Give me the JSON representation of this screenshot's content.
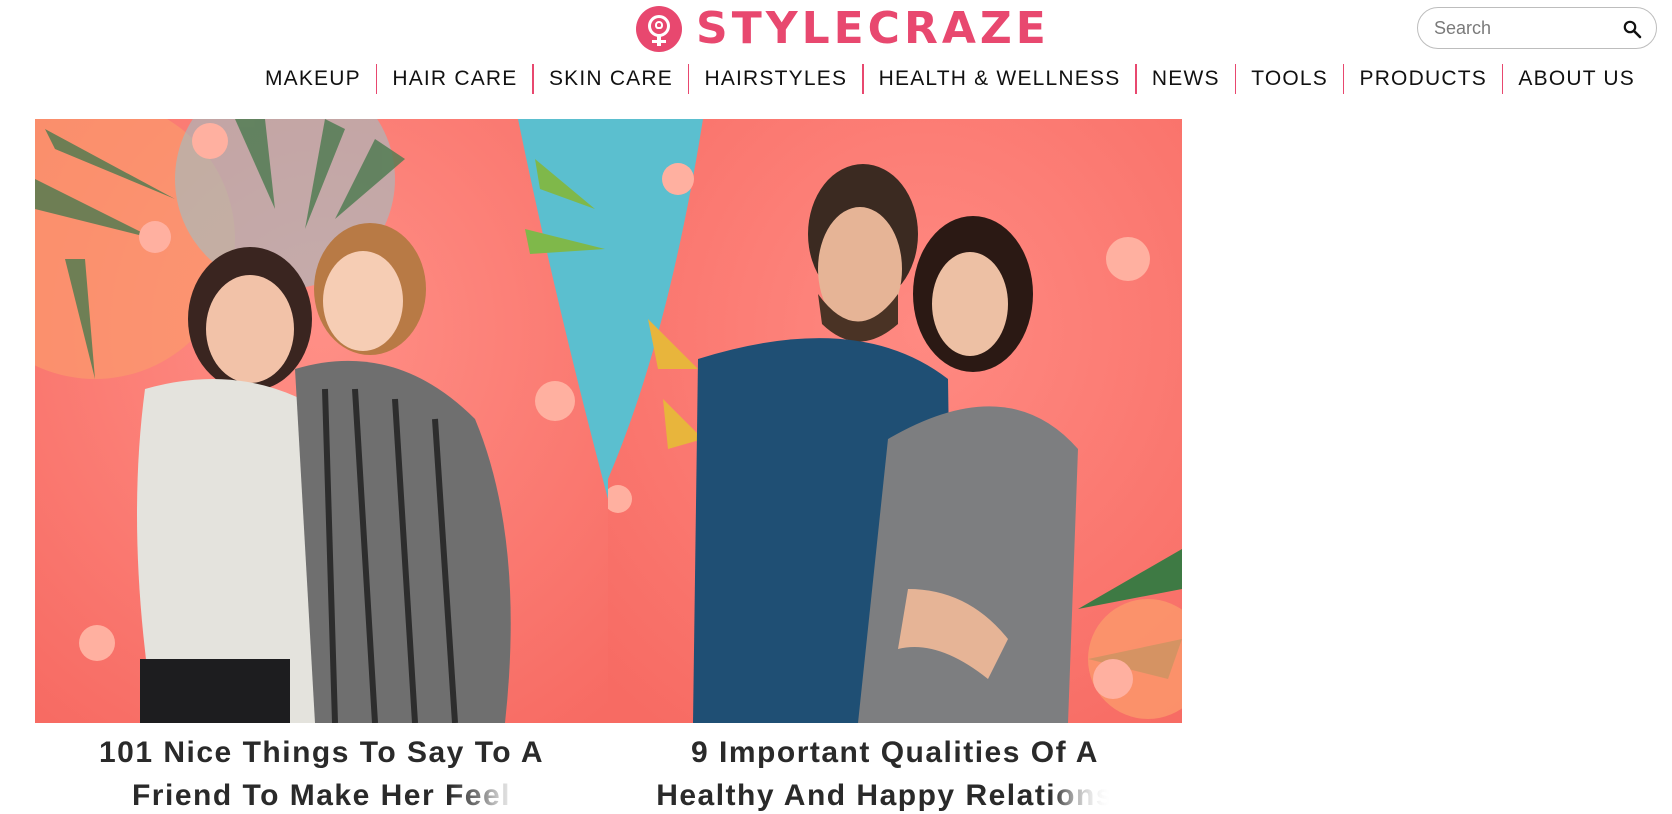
{
  "brand": {
    "name": "STYLECRAZE",
    "color": "#e8486f",
    "logo_icon": "venus-symbol-icon"
  },
  "search": {
    "placeholder": "Search",
    "icon": "search-icon"
  },
  "nav": {
    "items": [
      {
        "label": "MAKEUP"
      },
      {
        "label": "HAIR CARE"
      },
      {
        "label": "SKIN CARE"
      },
      {
        "label": "HAIRSTYLES"
      },
      {
        "label": "HEALTH & WELLNESS"
      },
      {
        "label": "NEWS"
      },
      {
        "label": "TOOLS"
      },
      {
        "label": "PRODUCTS"
      },
      {
        "label": "ABOUT US"
      }
    ],
    "separator_color": "#e8486f"
  },
  "articles": [
    {
      "title_line1": "101 Nice Things To Say To A",
      "title_line2": "Friend To Make Her Feel",
      "image": "two-women-hugging-photo"
    },
    {
      "title_line1": "9 Important Qualities Of A",
      "title_line2": "Healthy And Happy Relationsh",
      "image": "couple-embracing-photo"
    }
  ],
  "colors": {
    "image_background": "#f76b63",
    "accent_teal": "#5bbfcf"
  }
}
